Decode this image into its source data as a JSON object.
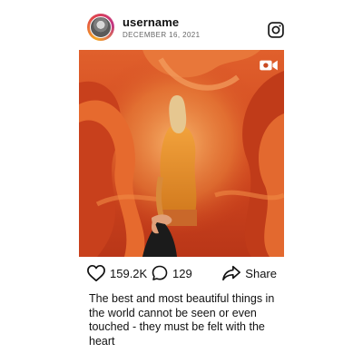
{
  "post": {
    "username": "username",
    "date": "DECEMBER 16, 2021",
    "likes": "159.2K",
    "comments": "129",
    "share_label": "Share",
    "caption": "The best and most beautiful things in the world cannot be seen or even touched - they must be felt with the heart"
  },
  "icons": {
    "header_right": "instagram-icon",
    "photo_badge": "camera-video-icon",
    "like": "heart-icon",
    "comment": "comment-bubble-icon",
    "share": "share-arrow-icon"
  },
  "colors": {
    "photo_red": "#c94a22",
    "accent_orange": "#e0792a"
  }
}
